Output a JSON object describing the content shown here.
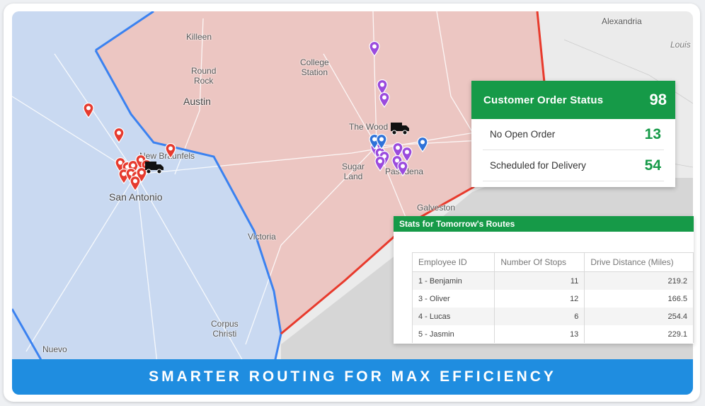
{
  "map": {
    "labels": {
      "killeen": "Killeen",
      "round_rock": "Round\nRock",
      "austin": "Austin",
      "college_station": "College\nStation",
      "the_woodlands": "The Wood",
      "sugar_land": "Sugar\nLand",
      "pasadena": "Pasadena",
      "galveston": "Galveston",
      "new_braunfels": "New Braunfels",
      "san_antonio": "San Antonio",
      "victoria": "Victoria",
      "corpus_christi": "Corpus\nChristi",
      "nuevo": "Nuevo",
      "alexandria": "Alexandria",
      "louis": "Louis"
    },
    "colors": {
      "west_region": "#c9d9f1",
      "east_region": "#ecc6c2",
      "west_border": "#3b82f0",
      "east_border": "#e83a2c",
      "marker_red": "#e63a2e",
      "marker_purple": "#9b4bdd",
      "marker_blue": "#2f72d8"
    }
  },
  "order_status": {
    "title": "Customer Order Status",
    "total": "98",
    "rows": [
      {
        "label": "No Open Order",
        "value": "13"
      },
      {
        "label": "Scheduled for Delivery",
        "value": "54"
      }
    ]
  },
  "route_stats": {
    "title": "Stats for Tomorrow's Routes",
    "columns": [
      "Employee ID",
      "Number Of Stops",
      "Drive Distance (Miles)"
    ],
    "rows": [
      [
        "1 - Benjamin",
        "11",
        "219.2"
      ],
      [
        "3 - Oliver",
        "12",
        "166.5"
      ],
      [
        "4 - Lucas",
        "6",
        "254.4"
      ],
      [
        "5 - Jasmin",
        "13",
        "229.1"
      ]
    ]
  },
  "banner": {
    "text": "SMARTER ROUTING FOR MAX EFFICIENCY"
  }
}
